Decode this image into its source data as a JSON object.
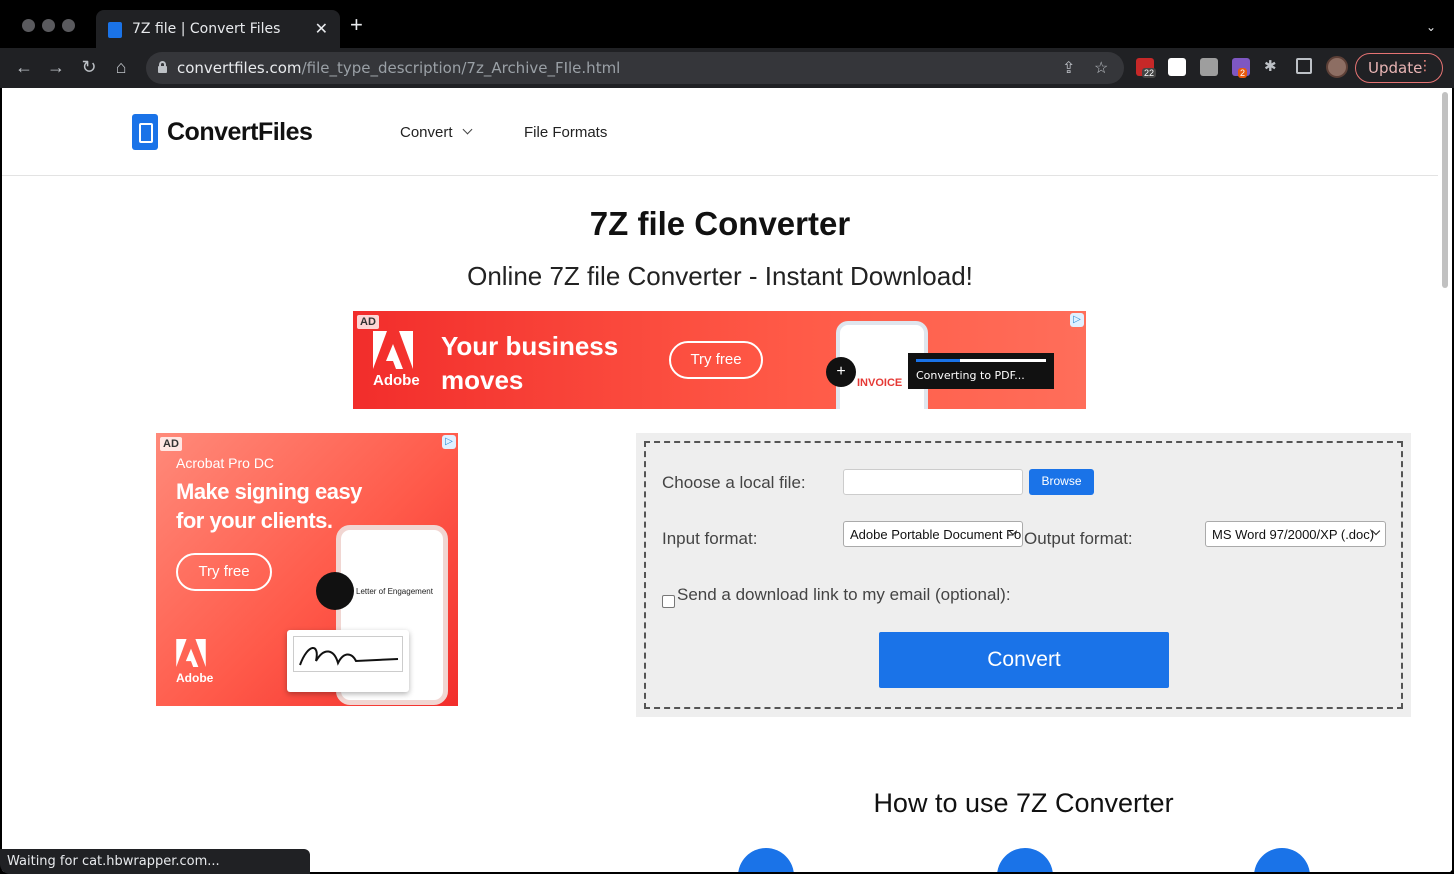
{
  "browser": {
    "tab": {
      "title": "7Z file | Convert Files"
    },
    "url": {
      "host": "convertfiles.com",
      "path": "/file_type_description/7z_Archive_FIle.html"
    },
    "extensions": [
      {
        "name": "abp-extension-icon",
        "badge": "22",
        "color": "#c62828"
      },
      {
        "name": "t-extension-icon",
        "badge": "",
        "color": "#ffffff"
      },
      {
        "name": "font-extension-icon",
        "badge": "",
        "color": "#9e9e9e"
      },
      {
        "name": "flower-extension-icon",
        "badge": "2",
        "color": "#7e57c2"
      }
    ],
    "update_label": "Update",
    "status_text": "Waiting for cat.hbwrapper.com..."
  },
  "site": {
    "logo": "ConvertFiles",
    "nav": {
      "convert": "Convert",
      "file_formats": "File Formats"
    }
  },
  "main": {
    "title": "7Z file Converter",
    "subtitle": "Online 7Z file Converter - Instant Download!",
    "howto_title": "How to use 7Z Converter"
  },
  "banner_ad": {
    "tag": "AD",
    "brand": "Adobe",
    "headline": "Your business moves",
    "cta": "Try free",
    "toast": "Converting to PDF...",
    "invoice": "INVOICE",
    "progress": 0.34
  },
  "side_ad": {
    "tag": "AD",
    "brand": "Adobe",
    "product": "Acrobat Pro DC",
    "headline": "Make signing easy for your clients.",
    "cta": "Try free",
    "doc_title": "Letter of Engagement"
  },
  "form": {
    "file_label": "Choose a local file:",
    "file_value": "",
    "browse": "Browse",
    "input_format_label": "Input format:",
    "input_format_value": "Adobe Portable Document Format (.pdf)",
    "output_format_label": "Output format:",
    "output_format_value": "MS Word 97/2000/XP (.doc)",
    "email_label": "Send a download link to my email (optional):",
    "email_checked": false,
    "convert": "Convert"
  },
  "colors": {
    "accent": "#1a73e8",
    "ad_red": "#f22d2b"
  }
}
